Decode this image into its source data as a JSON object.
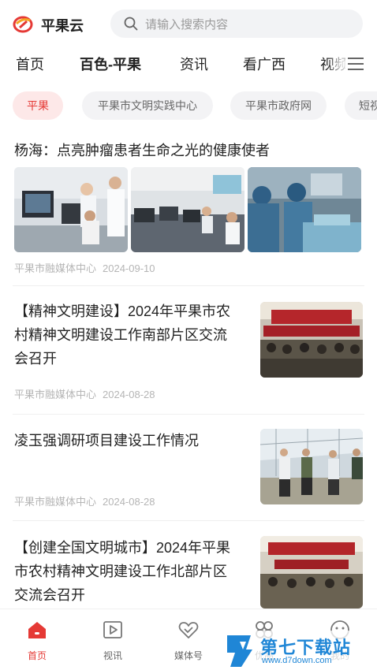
{
  "header": {
    "app_name": "平果云",
    "search_placeholder": "请输入搜索内容"
  },
  "channels": [
    {
      "label": "首页",
      "active": false
    },
    {
      "label": "百色-平果",
      "active": true
    },
    {
      "label": "资讯",
      "active": false
    },
    {
      "label": "看广西",
      "active": false
    },
    {
      "label": "视频",
      "active": false
    }
  ],
  "tags": [
    {
      "label": "平果",
      "active": true
    },
    {
      "label": "平果市文明实践中心",
      "active": false
    },
    {
      "label": "平果市政府网",
      "active": false
    },
    {
      "label": "短视",
      "active": false
    }
  ],
  "news": [
    {
      "title": "杨海：点亮肿瘤患者生命之光的健康使者",
      "source": "平果市融媒体中心",
      "date": "2024-09-10"
    },
    {
      "title_lines": [
        "【精神文明建设】2024年平果市农",
        "村精神文明建设工作南部片区交流",
        "会召开"
      ],
      "source": "平果市融媒体中心",
      "date": "2024-08-28"
    },
    {
      "title_lines": [
        "凌玉强调研项目建设工作情况"
      ],
      "source": "平果市融媒体中心",
      "date": "2024-08-28"
    },
    {
      "title_lines": [
        "【创建全国文明城市】2024年平果",
        "市农村精神文明建设工作北部片区",
        "交流会召开"
      ]
    }
  ],
  "bottom_nav": [
    {
      "label": "首页",
      "icon": "home-icon",
      "active": true
    },
    {
      "label": "视讯",
      "icon": "play-icon",
      "active": false
    },
    {
      "label": "媒体号",
      "icon": "heart-icon",
      "active": false
    },
    {
      "label": "优品",
      "icon": "clover-icon",
      "active": false
    },
    {
      "label": "我的",
      "icon": "smile-icon",
      "active": false
    }
  ],
  "watermark": {
    "text": "第七下载站",
    "url": "www.d7down.com"
  },
  "colors": {
    "accent": "#e53935",
    "watermark": "#1f86d6"
  }
}
